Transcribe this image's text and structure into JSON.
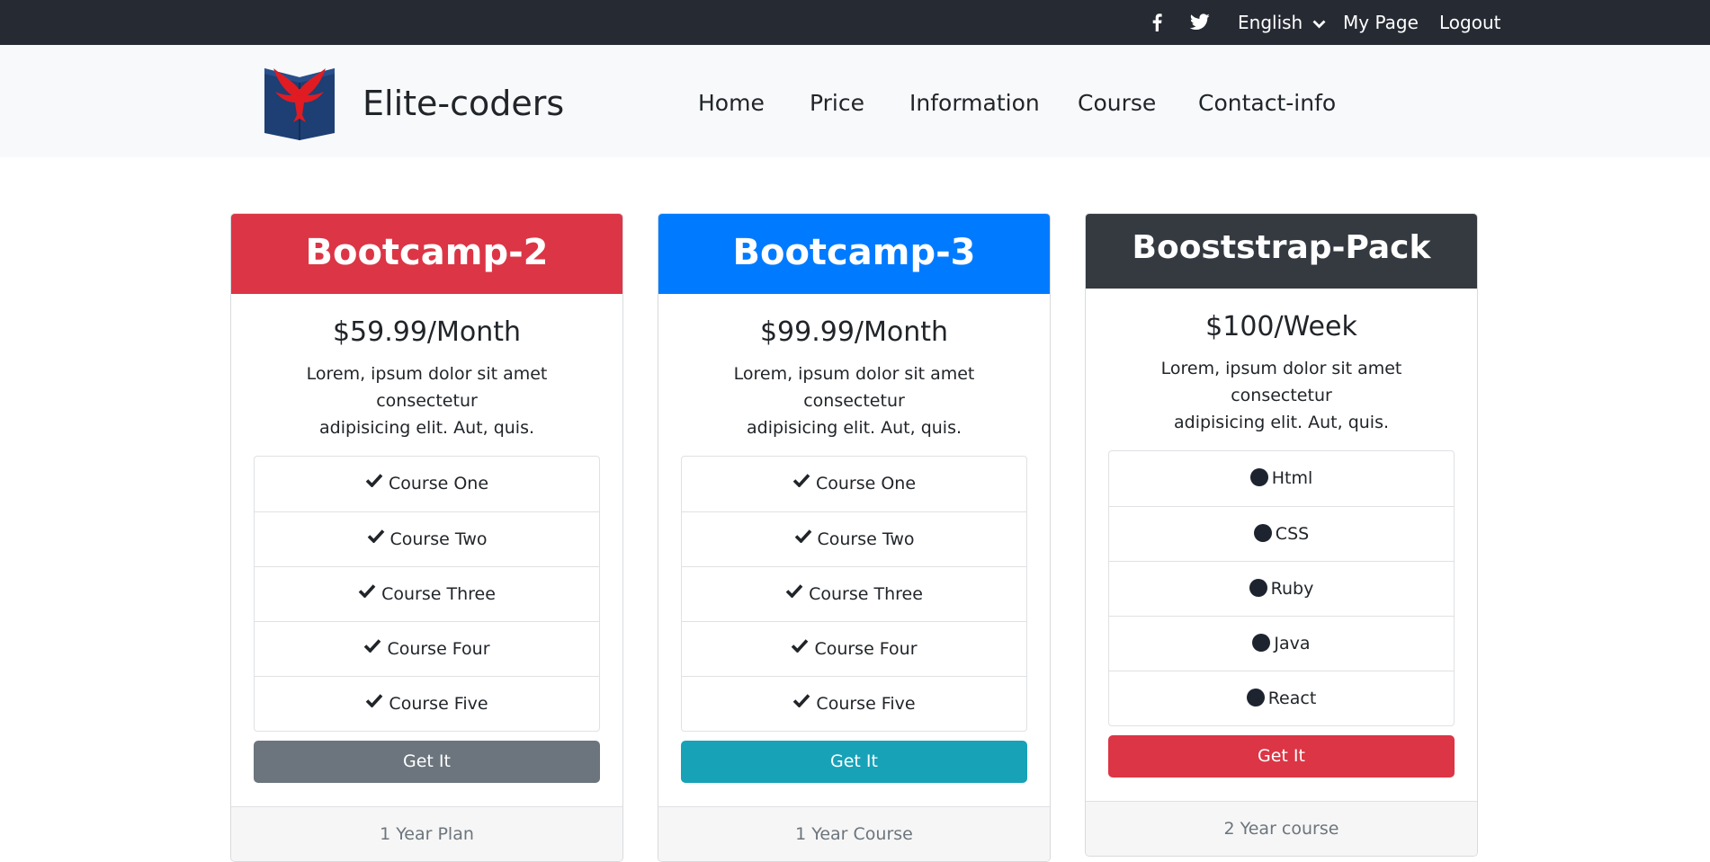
{
  "topbar": {
    "facebook_icon": "facebook-icon",
    "twitter_icon": "twitter-icon",
    "language": "English",
    "my_page": "My Page",
    "logout": "Logout"
  },
  "brand": {
    "name": "Elite-coders",
    "logo_icon": "eagle-book-logo"
  },
  "nav": {
    "items": [
      "Home",
      "Price",
      "Information",
      "Course",
      "Contact-info"
    ]
  },
  "cards": [
    {
      "title": "Bootcamp-2",
      "header_color": "#dc3545",
      "price": "$59.99/Month",
      "desc_line1": "Lorem, ipsum dolor sit amet consectetur",
      "desc_line2": "adipisicing elit. Aut, quis.",
      "item_icon": "check-icon",
      "items": [
        "Course One",
        "Course Two",
        "Course Three",
        "Course Four",
        "Course Five"
      ],
      "button": "Get It",
      "button_color": "#6c757d",
      "footer": "1 Year Plan"
    },
    {
      "title": "Bootcamp-3",
      "header_color": "#007bff",
      "price": "$99.99/Month",
      "desc_line1": "Lorem, ipsum dolor sit amet consectetur",
      "desc_line2": "adipisicing elit. Aut, quis.",
      "item_icon": "check-icon",
      "items": [
        "Course One",
        "Course Two",
        "Course Three",
        "Course Four",
        "Course Five"
      ],
      "button": "Get It",
      "button_color": "#17a2b8",
      "footer": "1 Year Course"
    },
    {
      "title": "Booststrap-Pack",
      "header_color": "#343a40",
      "price": "$100/Week",
      "desc_line1": "Lorem, ipsum dolor sit amet consectetur",
      "desc_line2": "adipisicing elit. Aut, quis.",
      "item_icon": "circle-bullet-icon",
      "items": [
        "Html",
        "CSS",
        "Ruby",
        "Java",
        "React"
      ],
      "button": "Get It",
      "button_color": "#dc3545",
      "footer": "2 Year course"
    }
  ]
}
